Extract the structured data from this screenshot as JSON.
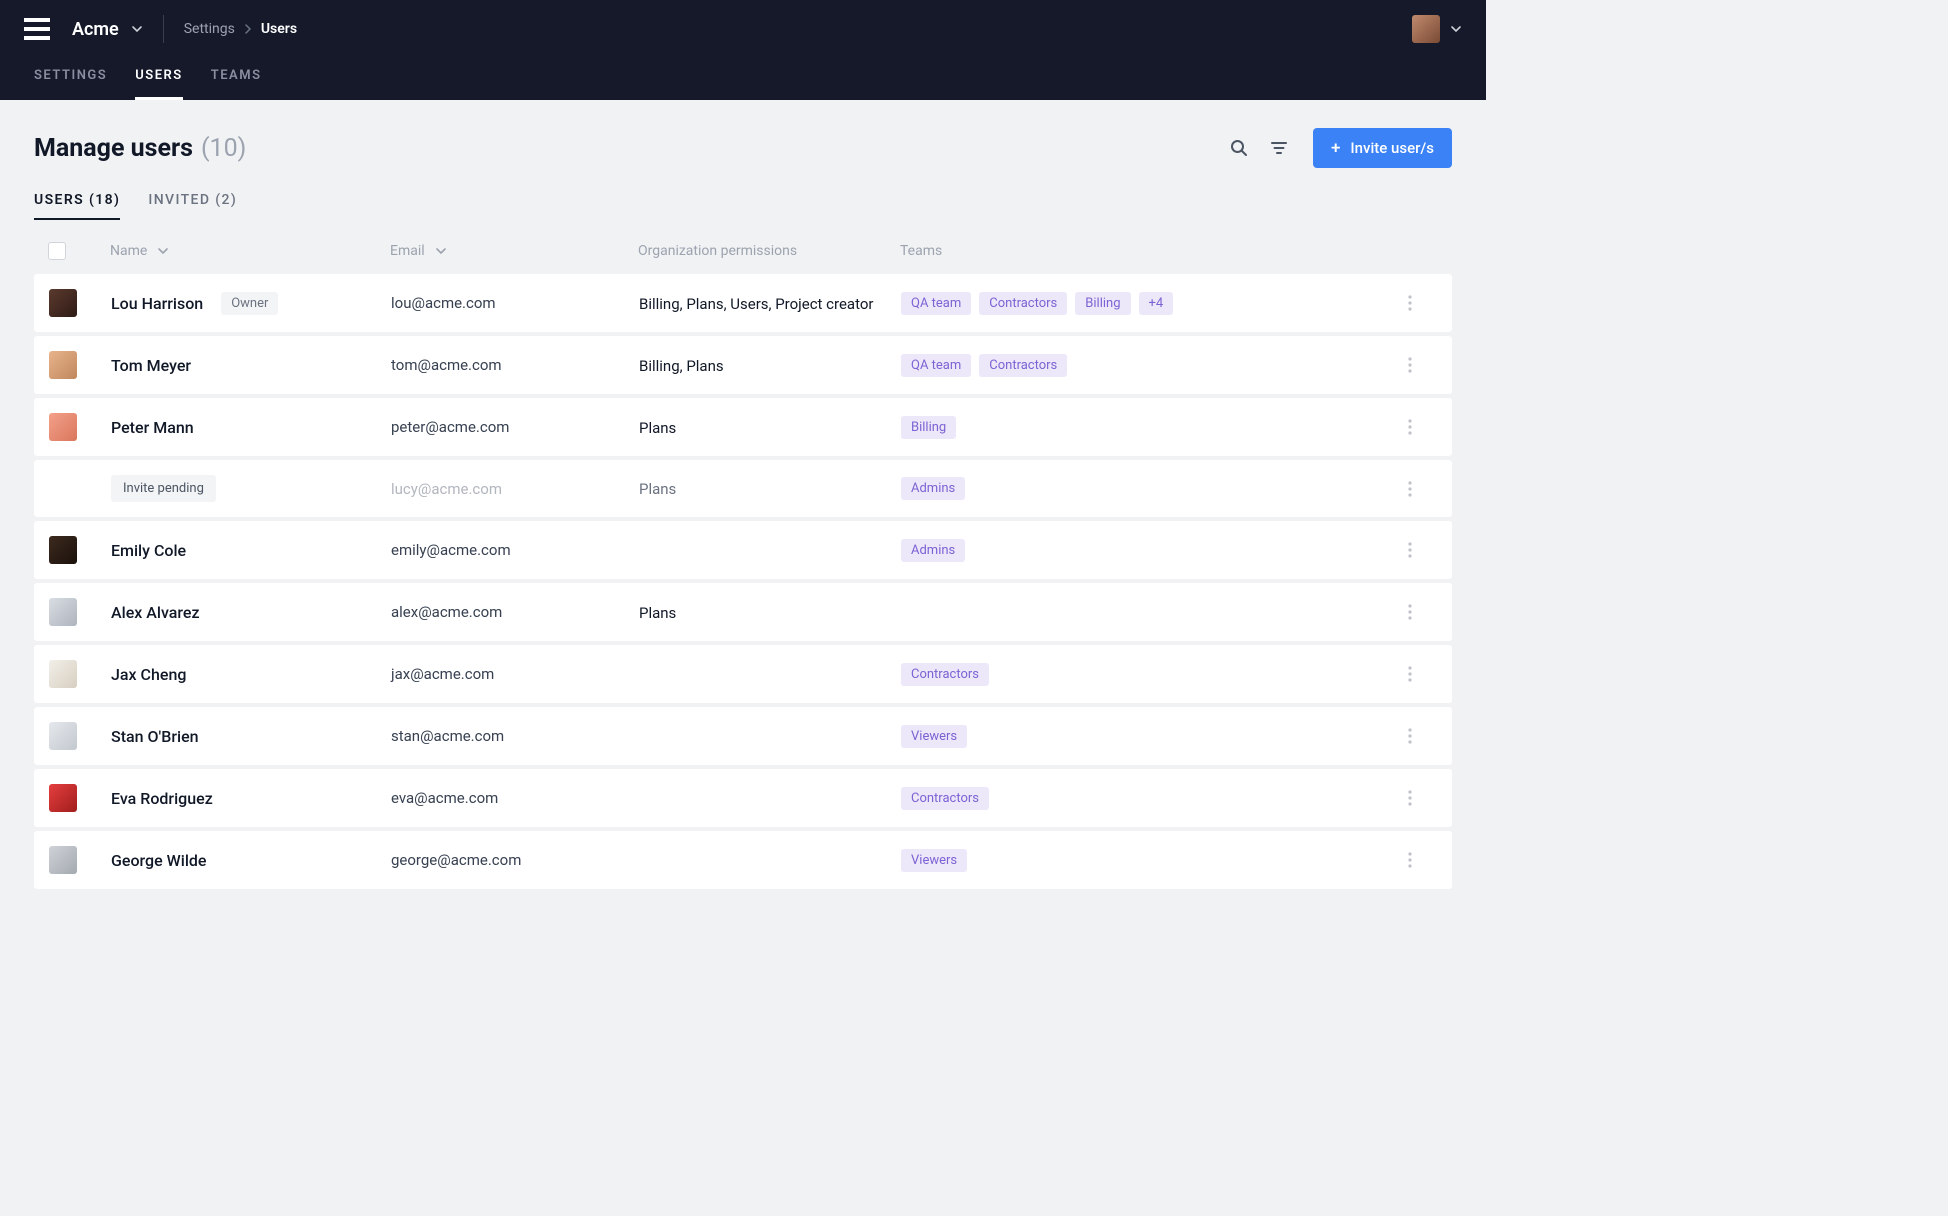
{
  "header": {
    "org_name": "Acme",
    "breadcrumb_root": "Settings",
    "breadcrumb_current": "Users",
    "nav": {
      "settings": "SETTINGS",
      "users": "USERS",
      "teams": "TEAMS"
    }
  },
  "page": {
    "title": "Manage users",
    "count": "(10)",
    "invite_button": "Invite user/s",
    "tabs": {
      "users": "USERS (18)",
      "invited": "INVITED (2)"
    }
  },
  "columns": {
    "name": "Name",
    "email": "Email",
    "permissions": "Organization permissions",
    "teams": "Teams"
  },
  "labels": {
    "owner": "Owner",
    "invite_pending": "Invite pending"
  },
  "users": [
    {
      "name": "Lou Harrison",
      "email": "lou@acme.com",
      "owner": true,
      "permissions": "Billing, Plans, Users, Project creator",
      "teams": [
        "QA team",
        "Contractors",
        "Billing",
        "+4"
      ]
    },
    {
      "name": "Tom Meyer",
      "email": "tom@acme.com",
      "permissions": "Billing, Plans",
      "teams": [
        "QA team",
        "Contractors"
      ]
    },
    {
      "name": "Peter Mann",
      "email": "peter@acme.com",
      "permissions": "Plans",
      "teams": [
        "Billing"
      ]
    },
    {
      "pending": true,
      "email": "lucy@acme.com",
      "permissions": "Plans",
      "teams": [
        "Admins"
      ]
    },
    {
      "name": "Emily Cole",
      "email": "emily@acme.com",
      "permissions": "",
      "teams": [
        "Admins"
      ]
    },
    {
      "name": "Alex Alvarez",
      "email": "alex@acme.com",
      "permissions": "Plans",
      "teams": []
    },
    {
      "name": "Jax Cheng",
      "email": "jax@acme.com",
      "permissions": "",
      "teams": [
        "Contractors"
      ]
    },
    {
      "name": "Stan O'Brien",
      "email": "stan@acme.com",
      "permissions": "",
      "teams": [
        "Viewers"
      ]
    },
    {
      "name": "Eva Rodriguez",
      "email": "eva@acme.com",
      "permissions": "",
      "teams": [
        "Contractors"
      ]
    },
    {
      "name": "George Wilde",
      "email": "george@acme.com",
      "permissions": "",
      "teams": [
        "Viewers"
      ]
    }
  ]
}
